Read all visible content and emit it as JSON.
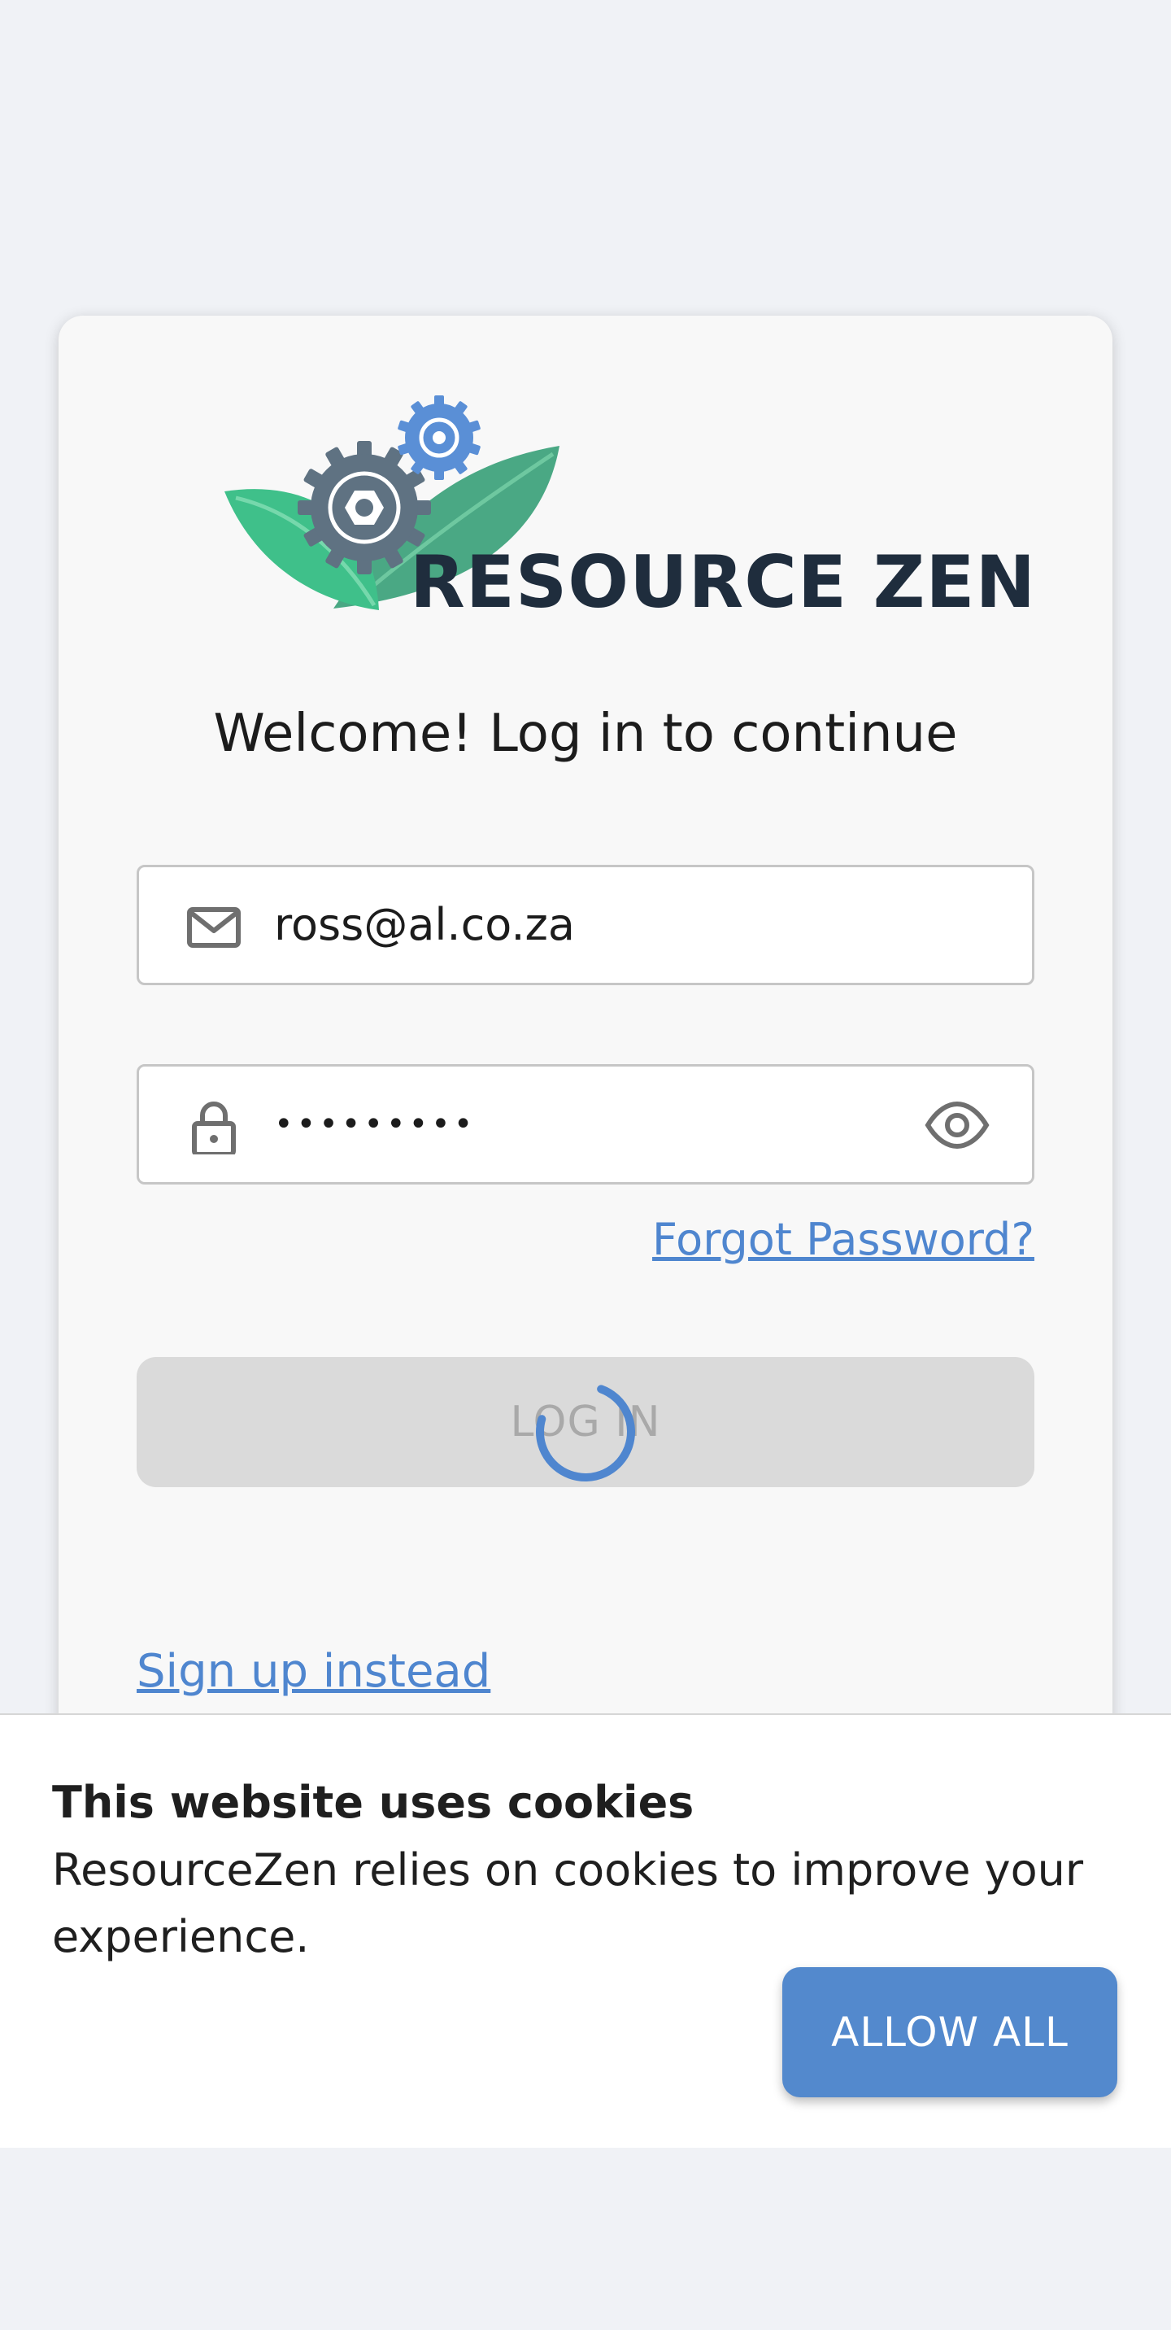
{
  "brand": {
    "name": "RESOURCE ZEN"
  },
  "login": {
    "welcome": "Welcome! Log in to continue",
    "email_value": "ross@al.co.za",
    "password_masked": "•••••••••",
    "forgot_label": "Forgot Password?",
    "login_label": "LOG IN",
    "signup_label": "Sign up instead",
    "icons": {
      "email": "mail-icon",
      "password": "lock-icon",
      "toggle": "eye-icon",
      "loading": "spinner-icon"
    }
  },
  "cookie": {
    "title": "This website uses cookies",
    "text": "ResourceZen relies on cookies to improve your experience.",
    "button_label": "ALLOW ALL"
  },
  "colors": {
    "accent": "#5389cd",
    "link": "#4f86cf",
    "background": "#f0f2f6",
    "card": "#f8f8f8",
    "disabled_button": "#dadada",
    "brand_text": "#1f2d3d",
    "leaf_green": "#4fbf8a",
    "gear_gray": "#5f7282",
    "gear_blue": "#5a8fd6"
  }
}
